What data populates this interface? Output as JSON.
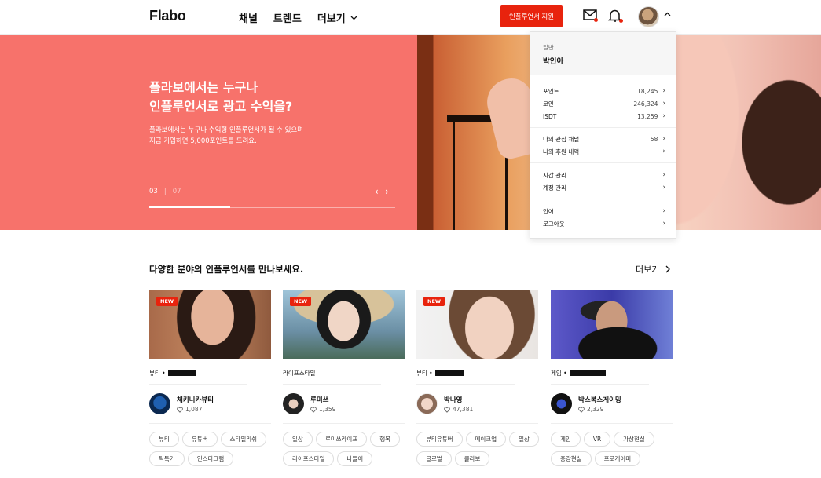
{
  "header": {
    "logo": "Flabo",
    "nav": [
      {
        "label": "채널"
      },
      {
        "label": "트렌드"
      },
      {
        "label": "더보기"
      }
    ],
    "apply_button": "인플루언서 지원",
    "icons": [
      "mail-icon",
      "bell-icon",
      "chevron-up-icon"
    ]
  },
  "hero": {
    "title_line1": "플라보에서는 누구나",
    "title_line2": "인플루언서로 광고 수익을?",
    "sub_line1": "플라보에서는 누구나 수익형 인플루언서가 될 수 있으며",
    "sub_line2": "지금 가입하면 5,000포인트를 드려요.",
    "page_current": "03",
    "page_sep": "|",
    "page_total": "07",
    "progress": 0.33
  },
  "dropdown": {
    "tier": "일반",
    "name": "박인아",
    "rows": [
      {
        "label": "포인트",
        "value": "18,245"
      },
      {
        "label": "코인",
        "value": "246,324"
      },
      {
        "label": "ISDT",
        "value": "13,259"
      },
      {
        "label": "나의 관심 채널",
        "value": "58"
      },
      {
        "label": "나의 후원 내역",
        "value": ""
      },
      {
        "label": "지갑 관리",
        "value": ""
      },
      {
        "label": "계정 관리",
        "value": ""
      },
      {
        "label": "언어",
        "value": ""
      },
      {
        "label": "로그아웃",
        "value": ""
      }
    ]
  },
  "section": {
    "title": "다양한 분야의 인플루언서를 만나보세요.",
    "more": "더보기"
  },
  "cards": [
    {
      "new": "NEW",
      "category": "뷰티 •",
      "name": "체키니카뷰티",
      "likes": "1,087",
      "tags": [
        "뷰티",
        "유튜버",
        "스타일리쉬",
        "틱톡커",
        "인스타그램"
      ]
    },
    {
      "new": "NEW",
      "category": "라이프스타일",
      "name": "루미쓰",
      "likes": "1,359",
      "tags": [
        "일상",
        "루미쓰라이프",
        "행복",
        "라이프스타일",
        "나들이"
      ]
    },
    {
      "new": "NEW",
      "category": "뷰티 •",
      "name": "박나영",
      "likes": "47,381",
      "tags": [
        "뷰티유튜버",
        "메이크업",
        "일상",
        "글로벌",
        "콜라보"
      ]
    },
    {
      "new": "",
      "category": "게임 •",
      "name": "박스복스게이밍",
      "likes": "2,329",
      "tags": [
        "게임",
        "VR",
        "가상현실",
        "증강현실",
        "프로게이머"
      ]
    }
  ]
}
